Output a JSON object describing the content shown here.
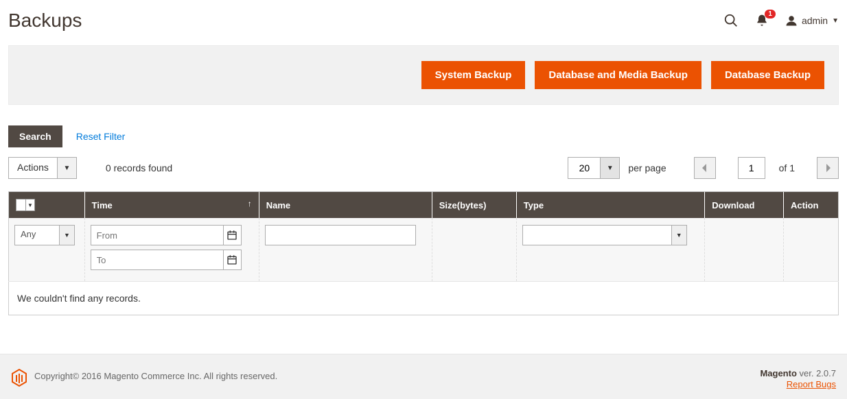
{
  "header": {
    "title": "Backups",
    "notification_count": "1",
    "admin_label": "admin"
  },
  "action_buttons": {
    "system_backup": "System Backup",
    "db_media_backup": "Database and Media Backup",
    "db_backup": "Database Backup"
  },
  "toolbar": {
    "search_label": "Search",
    "reset_filter_label": "Reset Filter",
    "actions_label": "Actions",
    "records_found": "0 records found",
    "per_page_value": "20",
    "per_page_label": "per page",
    "current_page": "1",
    "of_pages": "of 1"
  },
  "grid": {
    "columns": {
      "time": "Time",
      "name": "Name",
      "size": "Size(bytes)",
      "type": "Type",
      "download": "Download",
      "action": "Action"
    },
    "filters": {
      "select_any": "Any",
      "from_placeholder": "From",
      "to_placeholder": "To"
    },
    "empty_text": "We couldn't find any records."
  },
  "footer": {
    "copyright": "Copyright© 2016 Magento Commerce Inc. All rights reserved.",
    "brand": "Magento",
    "version_prefix": " ver. ",
    "version": "2.0.7",
    "report_bugs": "Report Bugs"
  }
}
